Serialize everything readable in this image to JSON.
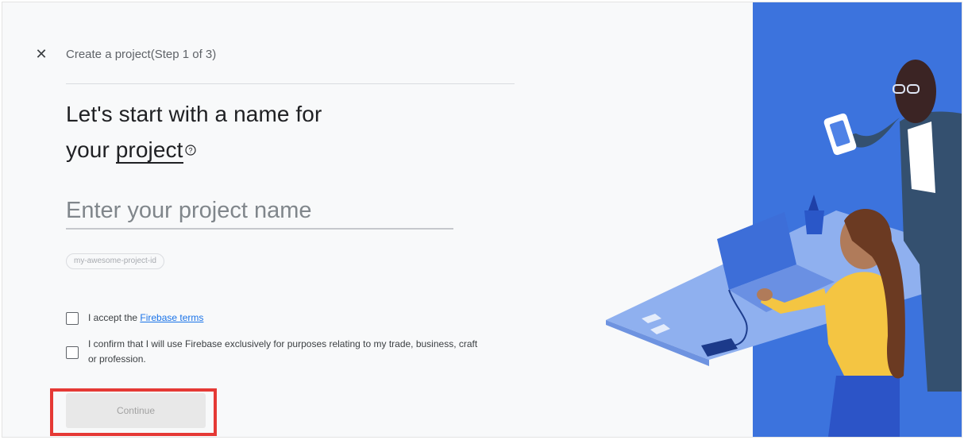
{
  "header": {
    "close_icon": "close-icon",
    "step_title": "Create a project(Step 1 of 3)"
  },
  "main": {
    "heading_line1": "Let's start with a name for",
    "heading_line2_prefix": "your ",
    "heading_underlined": "project",
    "help_icon": "help-circle-icon",
    "help_glyph": "?",
    "project_name_placeholder": "Enter your project name",
    "project_id_chip": "my-awesome-project-id"
  },
  "terms": {
    "accept_prefix": "I accept the ",
    "accept_link": "Firebase terms",
    "confirm_line1": "I confirm that I will use Firebase exclusively for purposes relating to my trade, business, craft",
    "confirm_line2": "or profession."
  },
  "footer": {
    "continue_label": "Continue"
  },
  "colors": {
    "accent_blue": "#3c73dd",
    "link": "#1a73e8",
    "highlight": "#e53935",
    "background": "#f8f9fa"
  }
}
